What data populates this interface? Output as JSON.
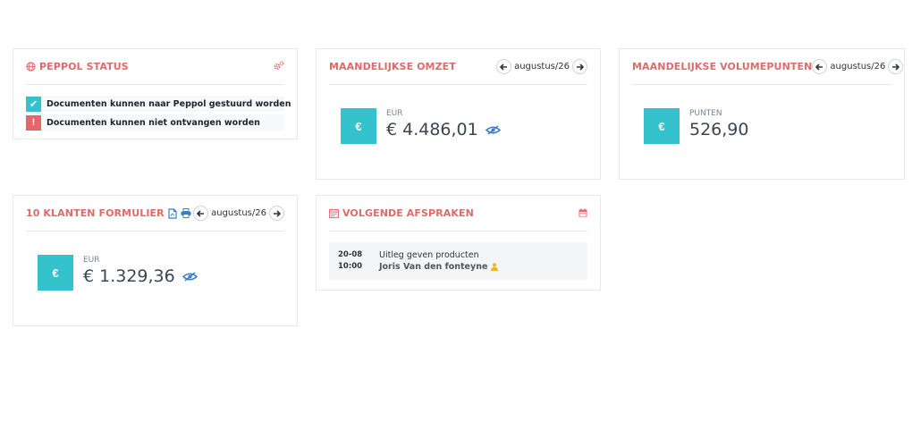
{
  "peppol": {
    "title": "PEPPOL STATUS",
    "icon": "globe-icon",
    "settings_icon": "gears-icon",
    "statuses": [
      {
        "text": "Documenten kunnen naar Peppol gestuurd worden",
        "state": "ok",
        "symbol": "✔",
        "color": "#34c3cd"
      },
      {
        "text": "Documenten kunnen niet ontvangen worden",
        "state": "error",
        "symbol": "!",
        "color": "#e8636a"
      }
    ]
  },
  "omzet": {
    "title": "MAANDELIJKSE OMZET",
    "period": "augustus/26",
    "symbol": "€",
    "unit": "EUR",
    "value": "€ 4.486,01"
  },
  "volume": {
    "title": "MAANDELIJKSE VOLUMEPUNTEN",
    "period": "augustus/26",
    "symbol": "€",
    "unit": "PUNTEN",
    "value": "526,90"
  },
  "klanten": {
    "title": "10 KLANTEN FORMULIER",
    "period": "augustus/26",
    "symbol": "€",
    "unit": "EUR",
    "value": "€ 1.329,36"
  },
  "afspraken": {
    "title": "VOLGENDE AFSPRAKEN",
    "items": [
      {
        "date": "20-08",
        "time": "10:00",
        "title": "Uitleg geven producten",
        "person": "Joris Van den fonteyne"
      }
    ]
  },
  "colors": {
    "accent_red": "#e06a6a",
    "teal": "#34c3cd",
    "error_red": "#e8636a",
    "link_blue": "#3a7fc1",
    "user_yellow": "#e8b923"
  }
}
